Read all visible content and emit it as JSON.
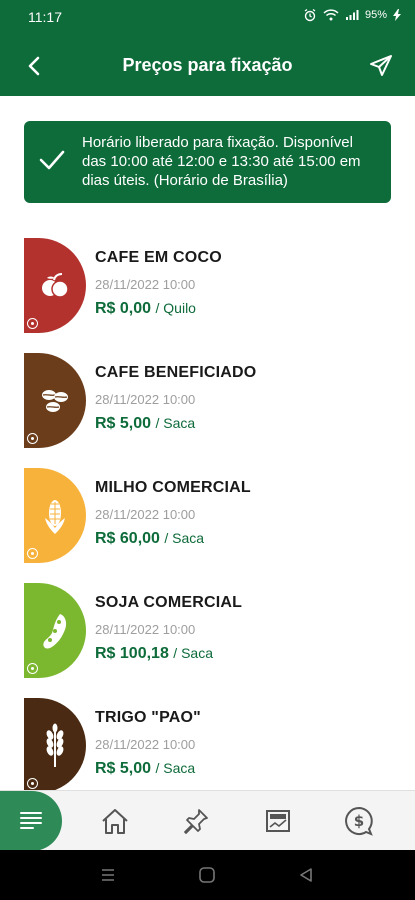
{
  "status_bar": {
    "time": "11:17",
    "battery": "95%"
  },
  "app_bar": {
    "title": "Preços para fixação"
  },
  "notice": {
    "text": "Horário liberado para fixação. Disponível das 10:00 até 12:00 e 13:30 até 15:00 em dias úteis. (Horário de Brasília)"
  },
  "items": [
    {
      "name": "CAFE EM COCO",
      "date": "28/11/2022 10:00",
      "price": "R$ 0,00",
      "unit": "/ Quilo",
      "color": "#b3322e",
      "icon": "coffee-cherry-icon"
    },
    {
      "name": "CAFE BENEFICIADO",
      "date": "28/11/2022 10:00",
      "price": "R$ 5,00",
      "unit": "/ Saca",
      "color": "#6b3d1b",
      "icon": "coffee-beans-icon"
    },
    {
      "name": "MILHO COMERCIAL",
      "date": "28/11/2022 10:00",
      "price": "R$ 60,00",
      "unit": "/ Saca",
      "color": "#f7b23b",
      "icon": "corn-icon"
    },
    {
      "name": "SOJA COMERCIAL",
      "date": "28/11/2022 10:00",
      "price": "R$ 100,18",
      "unit": "/ Saca",
      "color": "#7cb82f",
      "icon": "soybean-icon"
    },
    {
      "name": "TRIGO \"PAO\"",
      "date": "28/11/2022 10:00",
      "price": "R$ 5,00",
      "unit": "/ Saca",
      "color": "#4a2a12",
      "icon": "wheat-icon"
    }
  ],
  "colors": {
    "primary": "#0e6b3a",
    "accent": "#2e8b57"
  }
}
